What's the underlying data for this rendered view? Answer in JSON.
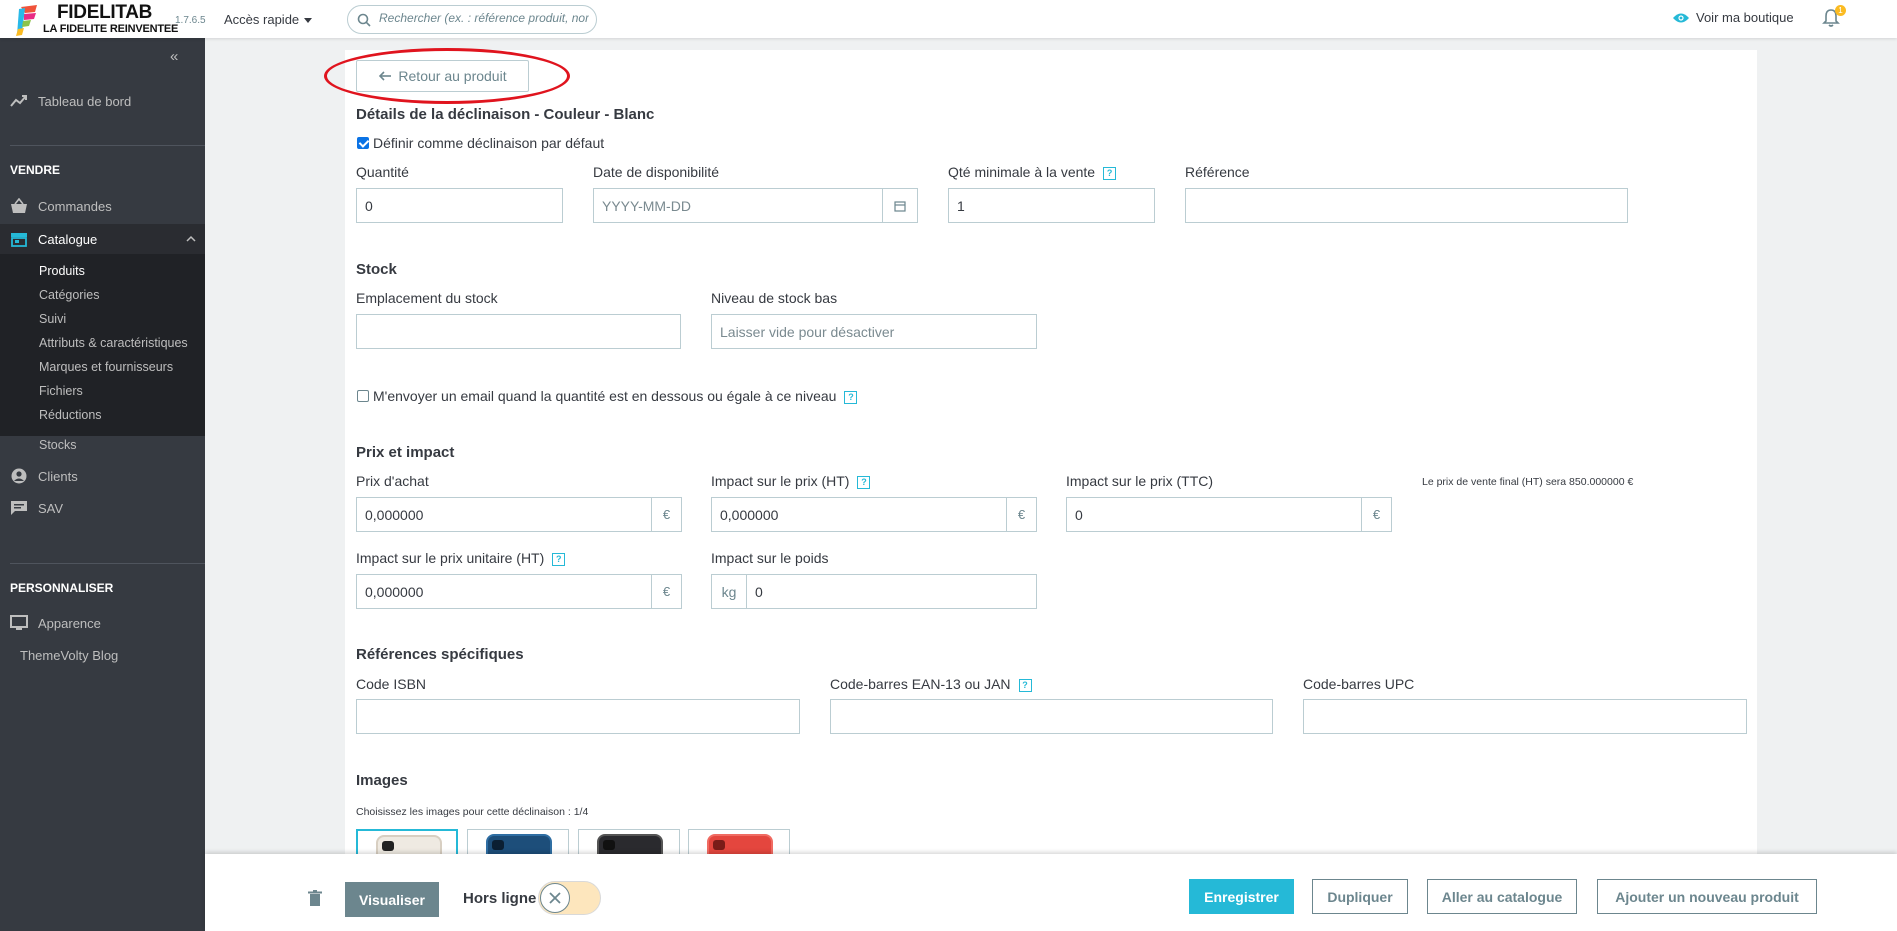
{
  "header": {
    "brand_title": "FIDELITAB",
    "brand_subtitle": "LA FIDELITE REINVENTEE",
    "version": "1.7.6.5",
    "quick_access": "Accès rapide",
    "search_placeholder": "Rechercher (ex. : référence produit, nom",
    "view_shop": "Voir ma boutique",
    "notifications_count": "1"
  },
  "sidebar": {
    "dashboard": "Tableau de bord",
    "section_sell": "VENDRE",
    "orders": "Commandes",
    "catalog": "Catalogue",
    "catalog_items": [
      "Produits",
      "Catégories",
      "Suivi",
      "Attributs & caractéristiques",
      "Marques et fournisseurs",
      "Fichiers",
      "Réductions",
      "Stocks"
    ],
    "customers": "Clients",
    "support": "SAV",
    "section_customize": "PERSONNALISER",
    "appearance": "Apparence",
    "blog": "ThemeVolty Blog"
  },
  "form": {
    "back_button": "Retour au produit",
    "title": "Détails de la déclinaison - Couleur - Blanc",
    "default_checkbox": "Définir comme déclinaison par défaut",
    "quantity_label": "Quantité",
    "quantity_value": "0",
    "availability_label": "Date de disponibilité",
    "availability_placeholder": "YYYY-MM-DD",
    "min_qty_label": "Qté minimale à la vente",
    "min_qty_value": "1",
    "reference_label": "Référence",
    "reference_value": "",
    "stock_title": "Stock",
    "stock_location_label": "Emplacement du stock",
    "stock_location_value": "",
    "low_stock_label": "Niveau de stock bas",
    "low_stock_placeholder": "Laisser vide pour désactiver",
    "email_checkbox": "M'envoyer un email quand la quantité est en dessous ou égale à ce niveau",
    "price_title": "Prix et impact",
    "purchase_price_label": "Prix d'achat",
    "purchase_price_value": "0,000000",
    "impact_ht_label": "Impact sur le prix (HT)",
    "impact_ht_value": "0,000000",
    "impact_ttc_label": "Impact sur le prix (TTC)",
    "impact_ttc_value": "0",
    "final_price_note": "Le prix de vente final (HT) sera 850.000000 €",
    "unit_impact_label": "Impact sur le prix unitaire (HT)",
    "unit_impact_value": "0,000000",
    "weight_impact_label": "Impact sur le poids",
    "weight_unit": "kg",
    "weight_value": "0",
    "currency": "€",
    "refs_title": "Références spécifiques",
    "isbn_label": "Code ISBN",
    "isbn_value": "",
    "ean_label": "Code-barres EAN-13 ou JAN",
    "ean_value": "",
    "upc_label": "Code-barres UPC",
    "upc_value": "",
    "images_title": "Images",
    "images_hint": "Choisissez les images pour cette déclinaison : 1/4",
    "help_glyph": "?"
  },
  "footer": {
    "preview": "Visualiser",
    "offline": "Hors ligne",
    "save": "Enregistrer",
    "duplicate": "Dupliquer",
    "go_catalog": "Aller au catalogue",
    "add_new": "Ajouter un nouveau produit"
  },
  "colors": {
    "accent": "#25b9d7",
    "sidebar_bg": "#363a41",
    "highlight": "#e0141e"
  }
}
